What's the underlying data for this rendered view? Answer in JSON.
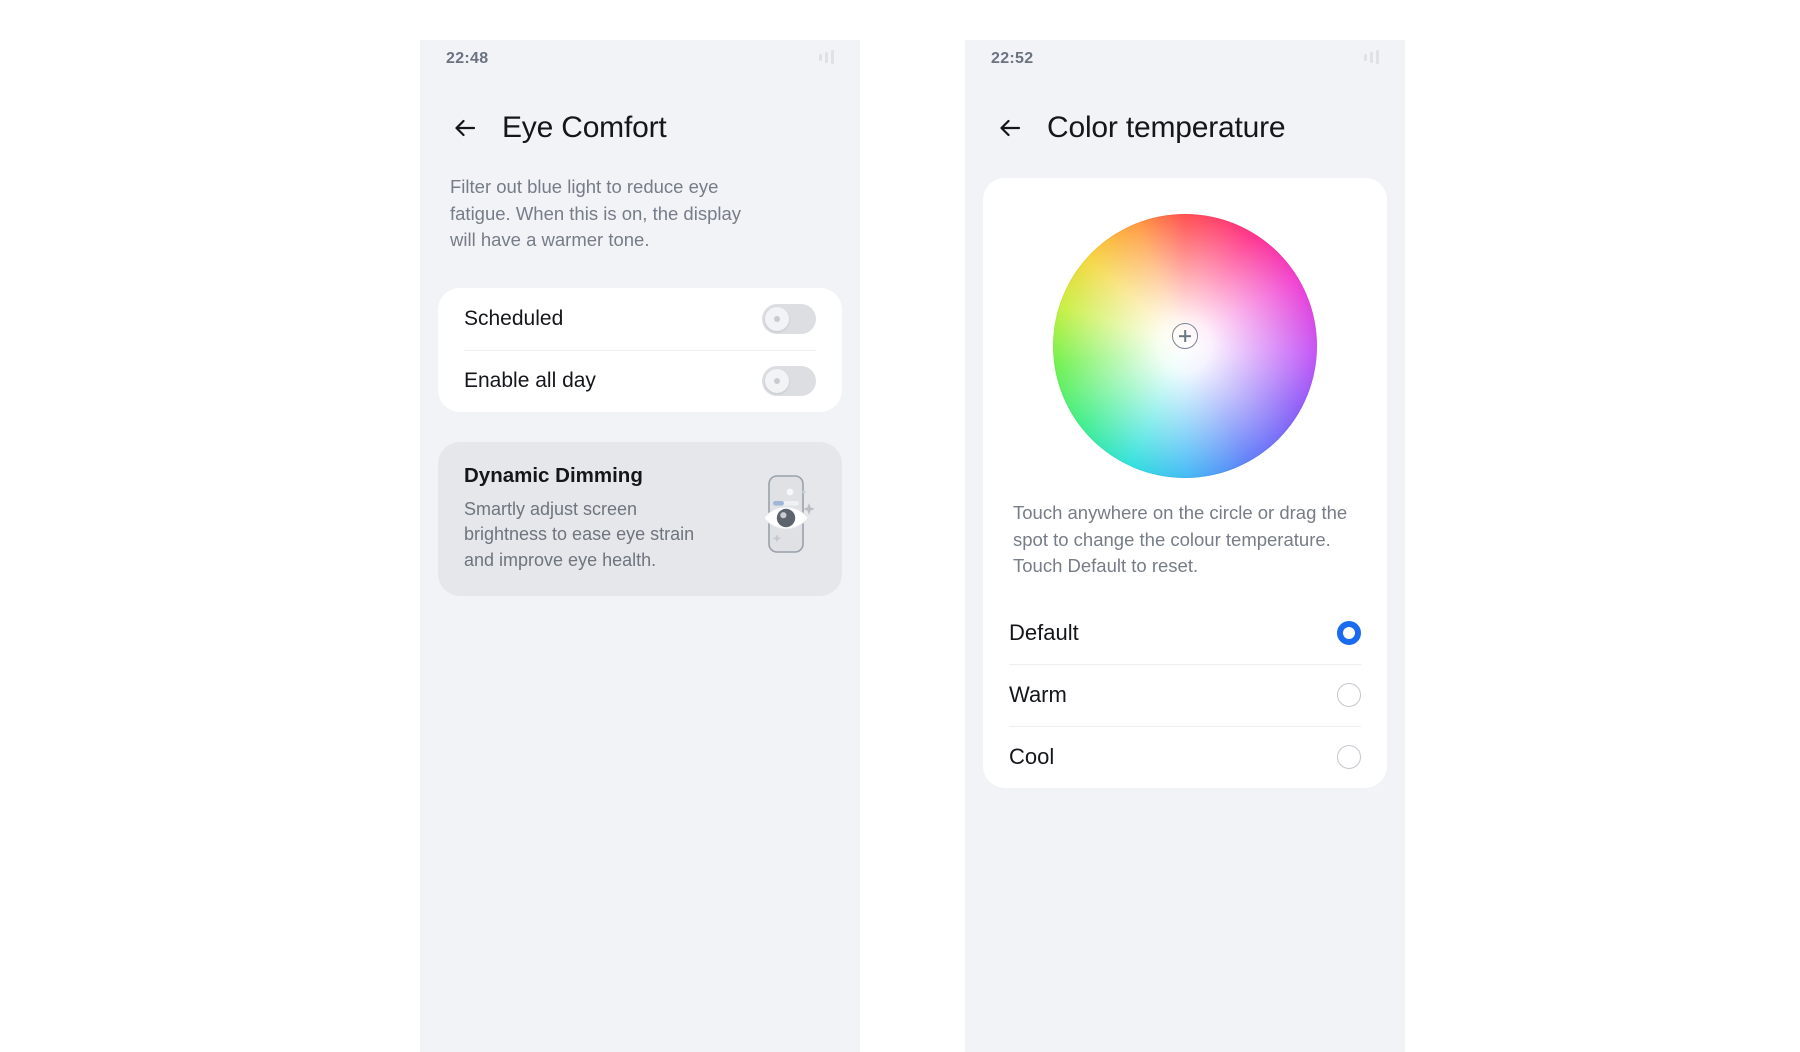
{
  "left_panel": {
    "status": {
      "time": "22:48",
      "signal_icon": "signal-bars-icon"
    },
    "back_icon": "back-arrow-icon",
    "title": "Eye Comfort",
    "intro": "Filter out blue light to reduce eye fatigue. When this is on, the display will have a warmer tone.",
    "settings": [
      {
        "label": "Scheduled",
        "toggle_on": false,
        "name": "scheduled"
      },
      {
        "label": "Enable all day",
        "toggle_on": false,
        "name": "enable-all-day"
      }
    ],
    "dynamic_dimming": {
      "title": "Dynamic Dimming",
      "description": "Smartly adjust screen brightness to ease eye strain and improve eye health.",
      "illustration_icon": "phone-eye-brightness-icon"
    }
  },
  "right_panel": {
    "status": {
      "time": "22:52",
      "signal_icon": "signal-bars-icon"
    },
    "back_icon": "back-arrow-icon",
    "title": "Color temperature",
    "color_wheel": {
      "icon": "color-wheel-picker",
      "marker_icon": "crosshair-plus-icon",
      "marker_position": "center"
    },
    "help": "Touch anywhere on the circle or drag the spot to change the colour temperature. Touch Default to reset.",
    "options": [
      {
        "label": "Default",
        "selected": true,
        "name": "default"
      },
      {
        "label": "Warm",
        "selected": false,
        "name": "warm"
      },
      {
        "label": "Cool",
        "selected": false,
        "name": "cool"
      }
    ]
  },
  "colors": {
    "panel_bg": "#f1f3f6",
    "card_bg": "#ffffff",
    "dd_card_bg": "#e5e7ea",
    "accent": "#1a6bf0",
    "title_text": "#14161a",
    "secondary_text": "#767d88",
    "switch_off": "#dcdee2"
  }
}
